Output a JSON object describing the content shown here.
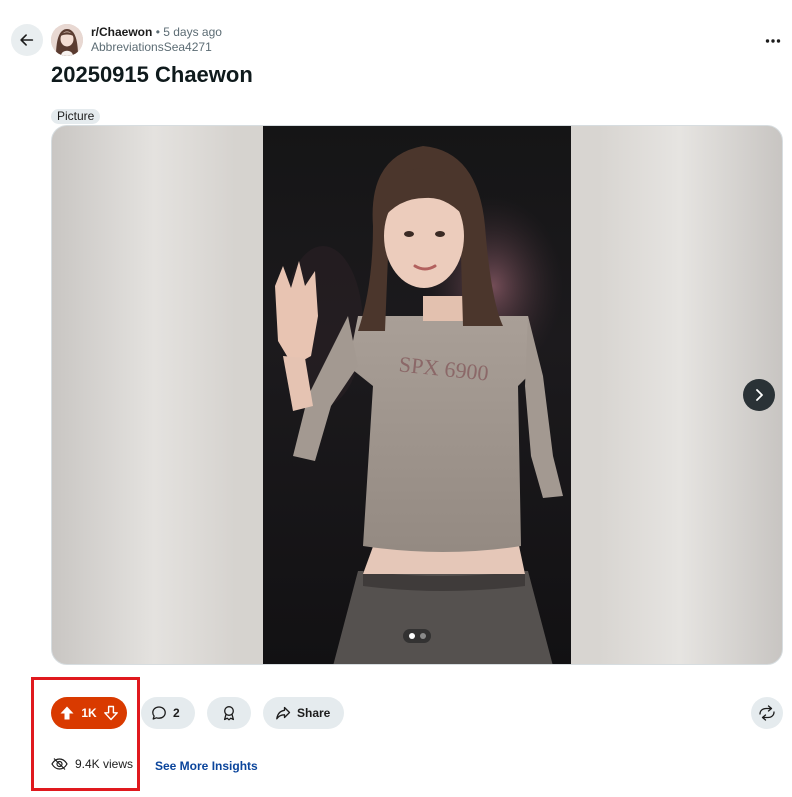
{
  "post": {
    "subreddit": "r/Chaewon",
    "separator": "•",
    "time_ago": "5 days ago",
    "author": "AbbreviationsSea4271",
    "title": "20250915 Chaewon",
    "flair": "Picture"
  },
  "gallery": {
    "next_icon": "chevron-right-icon",
    "active_index": 1,
    "total": 2,
    "shirt_text": "SPX 6900"
  },
  "actions": {
    "vote_count": "1K",
    "comment_count": "2",
    "share_label": "Share"
  },
  "insights": {
    "views": "9.4K views",
    "link": "See More Insights"
  },
  "colors": {
    "upvote_active": "#d93a00",
    "pill_bg": "#e5ebee",
    "link": "#0a449b",
    "highlight_box": "#e0191e"
  }
}
